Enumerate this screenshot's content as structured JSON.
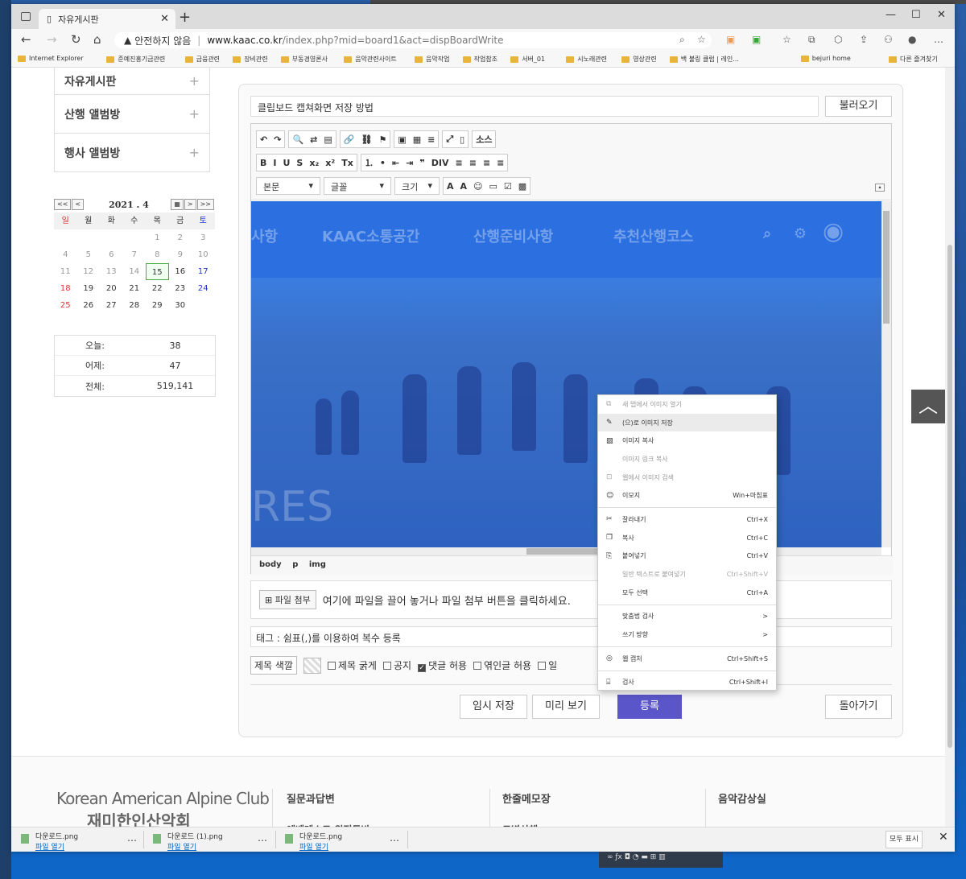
{
  "browser": {
    "tab_title": "자유게시판",
    "security_text": "안전하지 않음",
    "url_domain": "www.kaac.co.kr",
    "url_path": "/index.php?mid=board1&act=dispBoardWrite",
    "favorites": [
      "Internet Explorer",
      "준예진홍기금관련",
      "금융관련",
      "장비관련",
      "부동경영론사",
      "음악관련사이트",
      "음악작업",
      "작업참조",
      "서버_01",
      "시노래관련",
      "영상관련",
      "백 불링 클럽 | 레인...",
      "bejuri home"
    ],
    "other_favorites": "다른 즐겨찾기"
  },
  "sidebar": {
    "menu": [
      {
        "label": "자유게시판"
      },
      {
        "label": "산행 앨범방"
      },
      {
        "label": "행사 앨범방"
      }
    ],
    "calendar": {
      "title": "2021 . 4",
      "weekdays": [
        "일",
        "월",
        "화",
        "수",
        "목",
        "금",
        "토"
      ],
      "rows": [
        [
          "",
          "",
          "",
          "",
          "1",
          "2",
          "3"
        ],
        [
          "4",
          "5",
          "6",
          "7",
          "8",
          "9",
          "10"
        ],
        [
          "11",
          "12",
          "13",
          "14",
          "15",
          "16",
          "17"
        ],
        [
          "18",
          "19",
          "20",
          "21",
          "22",
          "23",
          "24"
        ],
        [
          "25",
          "26",
          "27",
          "28",
          "29",
          "30",
          ""
        ]
      ],
      "today": "15",
      "nav": [
        "<<",
        "<",
        "▦",
        ">",
        ">>"
      ]
    },
    "stats": [
      {
        "label": "오늘:",
        "value": "38"
      },
      {
        "label": "어제:",
        "value": "47"
      },
      {
        "label": "전체:",
        "value": "519,141"
      }
    ]
  },
  "form": {
    "title_value": "클립보드 캡쳐화면 저장 방법",
    "load_button": "불러오기",
    "toolbar": {
      "row1": [
        "↶",
        "↷",
        "🔍",
        "⇄",
        "▤",
        "🔗",
        "⛓",
        "⚑",
        "▣",
        "▦",
        "≡",
        "⤢",
        "▯",
        "소스"
      ],
      "row2": [
        "B",
        "I",
        "U",
        "S",
        "x₂",
        "x²",
        "Tx",
        "⒈",
        "•",
        "⇤",
        "⇥",
        "❞",
        "DIV",
        "≡",
        "≡",
        "≡",
        "≡"
      ],
      "format_select": "본문",
      "font_select": "글꼴",
      "size_select": "크기",
      "row3": [
        "A",
        "A",
        "☺",
        "▭",
        "☑",
        "▩"
      ]
    },
    "content_nav": [
      "사항",
      "KAAC소통공간",
      "산행준비사항",
      "추천산행코스"
    ],
    "content_watermark": "RES",
    "path_items": [
      "body",
      "p",
      "img"
    ],
    "attach_button": "파일 첨부",
    "attach_hint": "여기에 파일을 끌어 놓거나 파일 첨부 버튼을 클릭하세요.",
    "tags_placeholder": "태그 : 쉼표(,)를 이용하여 복수 등록",
    "options": {
      "title_color": "제목 색깔",
      "bold_title": "제목 굵게",
      "notice": "공지",
      "allow_comment": "댓글 허용",
      "allow_trackback": "엮인글 허용",
      "partial": "일"
    },
    "buttons": {
      "temp_save": "임시 저장",
      "preview": "미리 보기",
      "submit": "등록",
      "back": "돌아가기"
    }
  },
  "context_menu": [
    {
      "icon": "new-tab-icon",
      "glyph": "⧉",
      "label": "새 탭에서 이미지 열기",
      "shortcut": "",
      "disabled": true
    },
    {
      "icon": "save-image-icon",
      "glyph": "✎",
      "label": "(으)로 이미지 저장",
      "shortcut": "",
      "highlight": true
    },
    {
      "icon": "copy-image-icon",
      "glyph": "▨",
      "label": "이미지 복사",
      "shortcut": ""
    },
    {
      "icon": "",
      "glyph": "",
      "label": "이미지 링크 복사",
      "shortcut": "",
      "disabled": true
    },
    {
      "icon": "web-search-icon",
      "glyph": "⊡",
      "label": "웹에서 이미지 검색",
      "shortcut": "",
      "disabled": true
    },
    {
      "icon": "emoji-icon",
      "glyph": "☺",
      "label": "이모지",
      "shortcut": "Win+마침표"
    },
    {
      "sep": true
    },
    {
      "icon": "cut-icon",
      "glyph": "✂",
      "label": "잘라내기",
      "shortcut": "Ctrl+X"
    },
    {
      "icon": "copy-icon",
      "glyph": "❐",
      "label": "복사",
      "shortcut": "Ctrl+C"
    },
    {
      "icon": "paste-icon",
      "glyph": "⎘",
      "label": "붙여넣기",
      "shortcut": "Ctrl+V"
    },
    {
      "icon": "",
      "glyph": "",
      "label": "일반 텍스트로 붙여넣기",
      "shortcut": "Ctrl+Shift+V",
      "disabled": true
    },
    {
      "icon": "",
      "glyph": "",
      "label": "모두 선택",
      "shortcut": "Ctrl+A"
    },
    {
      "sep": true
    },
    {
      "icon": "",
      "glyph": "",
      "label": "맞춤법 검사",
      "shortcut": ">"
    },
    {
      "icon": "",
      "glyph": "",
      "label": "쓰기 방향",
      "shortcut": ">"
    },
    {
      "sep": true
    },
    {
      "icon": "web-capture-icon",
      "glyph": "◎",
      "label": "웹 캡처",
      "shortcut": "Ctrl+Shift+S"
    },
    {
      "sep": true
    },
    {
      "icon": "inspect-icon",
      "glyph": "⌸",
      "label": "검사",
      "shortcut": "Ctrl+Shift+I"
    }
  ],
  "footer": {
    "logo_en": "Korean American Alpine Club",
    "logo_ko": "재미한인산악회",
    "columns": [
      "질문과답변",
      "한줄메모장",
      "음악감상실"
    ],
    "subs": [
      "에베레스트 원정등반",
      "트벽상해"
    ]
  },
  "downloads": {
    "items": [
      {
        "name": "다운로드.png",
        "link": "파일 열기"
      },
      {
        "name": "다운로드 (1).png",
        "link": "파일 열기"
      },
      {
        "name": "다운로드.png",
        "link": "파일 열기"
      }
    ],
    "show_all": "모두 표시"
  }
}
